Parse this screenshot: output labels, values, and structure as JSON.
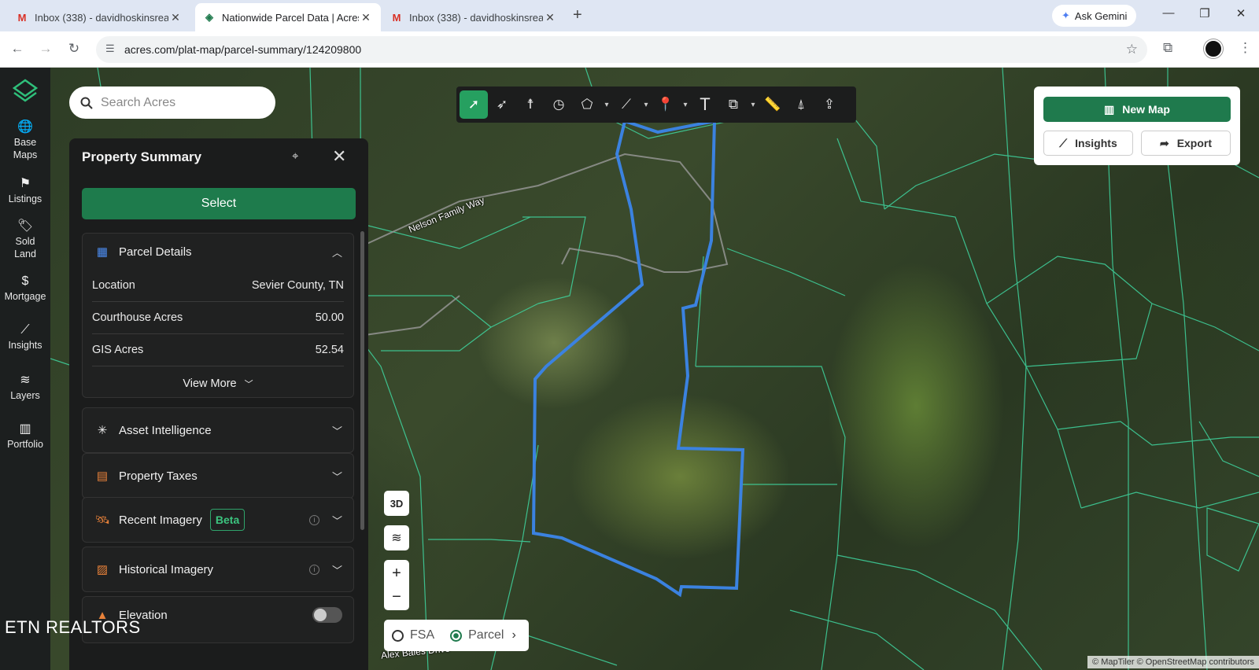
{
  "browser": {
    "tabs": [
      {
        "title": "Inbox (338) - davidhoskinsrealt",
        "active": false,
        "icon": "gmail-icon"
      },
      {
        "title": "Nationwide Parcel Data | Acres",
        "active": true,
        "icon": "acres-icon"
      },
      {
        "title": "Inbox (338) - davidhoskinsrealt",
        "active": false,
        "icon": "gmail-icon"
      }
    ],
    "gemini_label": "Ask Gemini",
    "url": "acres.com/plat-map/parcel-summary/124209800"
  },
  "sidebar": {
    "items": [
      {
        "label_1": "Base",
        "label_2": "Maps",
        "icon": "globe-icon"
      },
      {
        "label_1": "Listings",
        "label_2": "",
        "icon": "flag-icon"
      },
      {
        "label_1": "Sold",
        "label_2": "Land",
        "icon": "tag-icon"
      },
      {
        "label_1": "Mortgage",
        "label_2": "",
        "icon": "dollar-icon"
      },
      {
        "label_1": "Insights",
        "label_2": "",
        "icon": "chart-icon"
      },
      {
        "label_1": "Layers",
        "label_2": "",
        "icon": "layers-icon"
      },
      {
        "label_1": "Portfolio",
        "label_2": "",
        "icon": "map-icon"
      }
    ],
    "watermark": "ETN REALTORS"
  },
  "search": {
    "placeholder": "Search Acres"
  },
  "panel": {
    "title": "Property Summary",
    "select_label": "Select",
    "parcel_details": {
      "title": "Parcel Details",
      "rows": [
        {
          "label": "Location",
          "value": "Sevier County, TN"
        },
        {
          "label": "Courthouse Acres",
          "value": "50.00"
        },
        {
          "label": "GIS Acres",
          "value": "52.54"
        }
      ],
      "view_more": "View More"
    },
    "sections": {
      "asset_intelligence": "Asset Intelligence",
      "property_taxes": "Property Taxes",
      "recent_imagery": "Recent Imagery",
      "beta_badge": "Beta",
      "historical_imagery": "Historical Imagery",
      "elevation": "Elevation"
    }
  },
  "right_card": {
    "new_map": "New Map",
    "insights": "Insights",
    "export": "Export"
  },
  "map": {
    "btn_3d": "3D",
    "legend": {
      "fsa": "FSA",
      "parcel": "Parcel"
    },
    "roads": {
      "nelson": "Nelson Family Way",
      "bales": "Alex Bales Drive"
    },
    "attribution": "© MapTiler © OpenStreetMap contributors",
    "colors": {
      "selected_parcel": "#3b82e0",
      "parcel_lines": "#3fd6a0",
      "brand_green": "#1f7a4d"
    }
  }
}
